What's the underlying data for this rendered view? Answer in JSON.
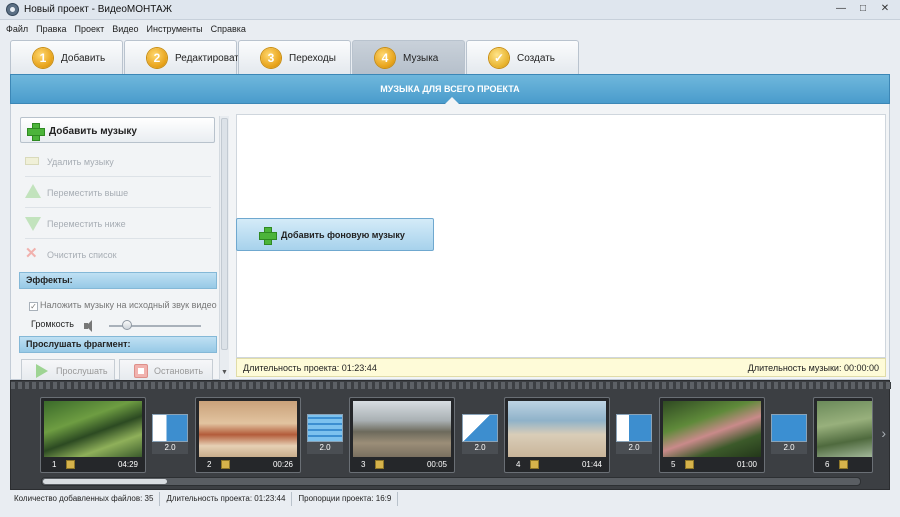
{
  "window": {
    "title": "Новый проект - ВидеоМОНТАЖ",
    "controls": [
      "—",
      "□",
      "✕"
    ]
  },
  "menu": [
    "Файл",
    "Правка",
    "Проект",
    "Видео",
    "Инструменты",
    "Справка"
  ],
  "tabs": [
    {
      "num": "1",
      "label": "Добавить"
    },
    {
      "num": "2",
      "label": "Редактировать"
    },
    {
      "num": "3",
      "label": "Переходы"
    },
    {
      "num": "4",
      "label": "Музыка",
      "active": true
    },
    {
      "num": "✓",
      "label": "Создать"
    }
  ],
  "header": {
    "title": "МУЗЫКА ДЛЯ ВСЕГО ПРОЕКТА"
  },
  "left_panel": {
    "add_music": "Добавить музыку",
    "remove_music": "Удалить музыку",
    "move_up": "Переместить выше",
    "move_down": "Переместить ниже",
    "clear_list": "Очистить список",
    "effects_title": "Эффекты:",
    "overlay_checkbox": "Наложить музыку на исходный звук видео",
    "overlay_checked": true,
    "volume_label": "Громкость",
    "volume_level": 0.2,
    "preview_title": "Прослушать фрагмент:",
    "play": "Прослушать",
    "stop": "Остановить"
  },
  "main": {
    "add_bg_music": "Добавить фоновую музыку",
    "project_duration": "Длительность проекта: 01:23:44",
    "music_duration": "Длительность музыки: 00:00:00"
  },
  "filmstrip": {
    "clips": [
      {
        "index": "1",
        "duration": "04:29"
      },
      {
        "index": "2",
        "duration": "00:26"
      },
      {
        "index": "3",
        "duration": "00:05"
      },
      {
        "index": "4",
        "duration": "01:44"
      },
      {
        "index": "5",
        "duration": "01:00"
      },
      {
        "index": "6",
        "duration": ""
      }
    ],
    "transitions": [
      "2.0",
      "2.0",
      "2.0",
      "2.0",
      "2.0"
    ]
  },
  "status": {
    "files": "Количество добавленных файлов: 35",
    "duration": "Длительность проекта: 01:23:44",
    "ratio": "Пропорции проекта: 16:9"
  },
  "colors": {
    "accent": "#4a9ccc",
    "tab_number": "#e6a016"
  }
}
